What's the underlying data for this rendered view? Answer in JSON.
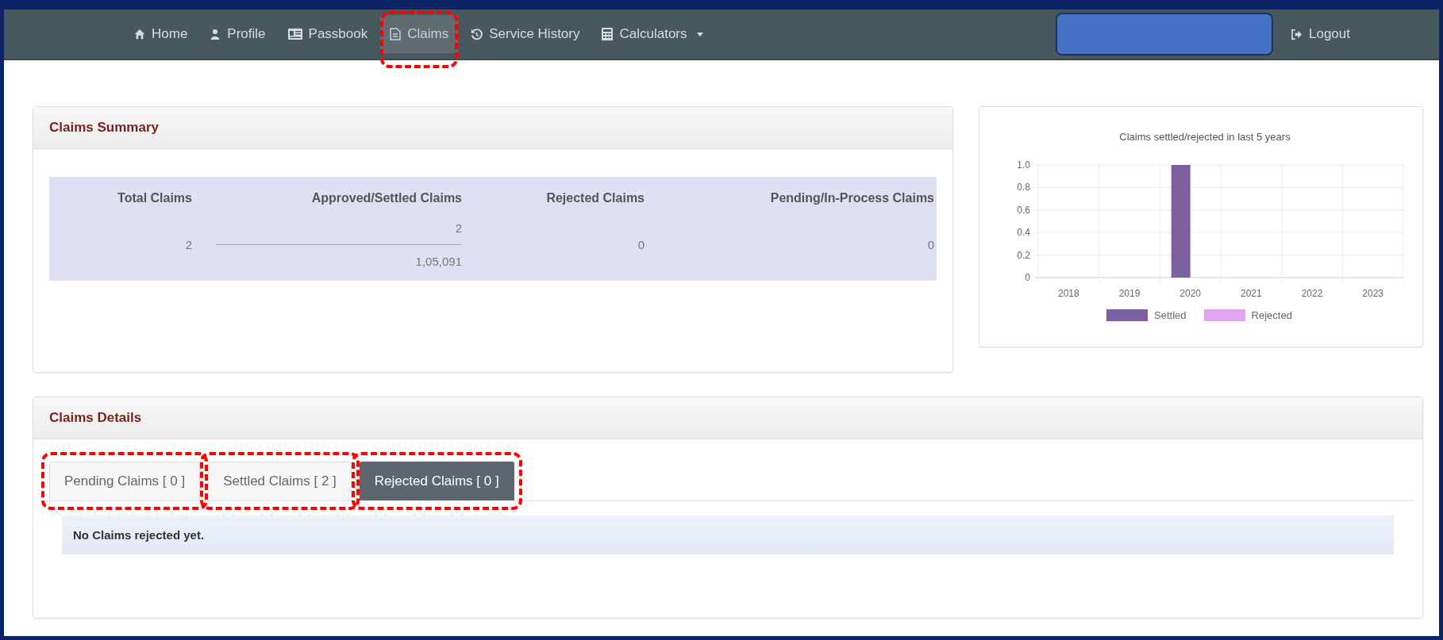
{
  "nav": {
    "items": [
      {
        "label": "Home",
        "selected": false,
        "highlighted": false,
        "dropdown": false
      },
      {
        "label": "Profile",
        "selected": false,
        "highlighted": false,
        "dropdown": false
      },
      {
        "label": "Passbook",
        "selected": false,
        "highlighted": false,
        "dropdown": false
      },
      {
        "label": "Claims",
        "selected": true,
        "highlighted": true,
        "dropdown": false
      },
      {
        "label": "Service History",
        "selected": false,
        "highlighted": false,
        "dropdown": false
      },
      {
        "label": "Calculators",
        "selected": false,
        "highlighted": false,
        "dropdown": true
      }
    ],
    "user_redacted": true,
    "logout": "Logout"
  },
  "summary": {
    "title": "Claims Summary",
    "columns": [
      "Total Claims",
      "Approved/Settled Claims",
      "Rejected Claims",
      "Pending/In-Process Claims"
    ],
    "values": [
      {
        "kind": "single",
        "value": "2"
      },
      {
        "kind": "split",
        "count": "2",
        "amount": "1,05,091"
      },
      {
        "kind": "single",
        "value": "0"
      },
      {
        "kind": "single",
        "value": "0"
      }
    ]
  },
  "chart": {
    "chart_data": {
      "type": "bar",
      "title": "Claims settled/rejected in last 5 years",
      "categories": [
        "2018",
        "2019",
        "2020",
        "2021",
        "2022",
        "2023"
      ],
      "series": [
        {
          "name": "Settled",
          "color": "#7b5fa0",
          "values": [
            0,
            0,
            1,
            0,
            0,
            0
          ]
        },
        {
          "name": "Rejected",
          "color": "#dfa6f0",
          "values": [
            0,
            0,
            0,
            0,
            0,
            0
          ]
        }
      ],
      "ylim": [
        0,
        1
      ],
      "grid": true,
      "yticks": [
        {
          "value": 0,
          "label": "0"
        },
        {
          "value": 0.2,
          "label": "0.2"
        },
        {
          "value": 0.4,
          "label": "0.4"
        },
        {
          "value": 0.6,
          "label": "0.6"
        },
        {
          "value": 0.8,
          "label": "0.8"
        },
        {
          "value": 1,
          "label": "1.0"
        }
      ]
    }
  },
  "details": {
    "title": "Claims Details",
    "tabs": [
      {
        "label": "Pending Claims [ 0 ]",
        "selected": false,
        "highlighted": true
      },
      {
        "label": "Settled Claims [ 2 ]",
        "selected": false,
        "highlighted": true
      },
      {
        "label": "Rejected Claims [ 0 ]",
        "selected": true,
        "highlighted": true
      }
    ],
    "message": "No Claims rejected yet."
  }
}
